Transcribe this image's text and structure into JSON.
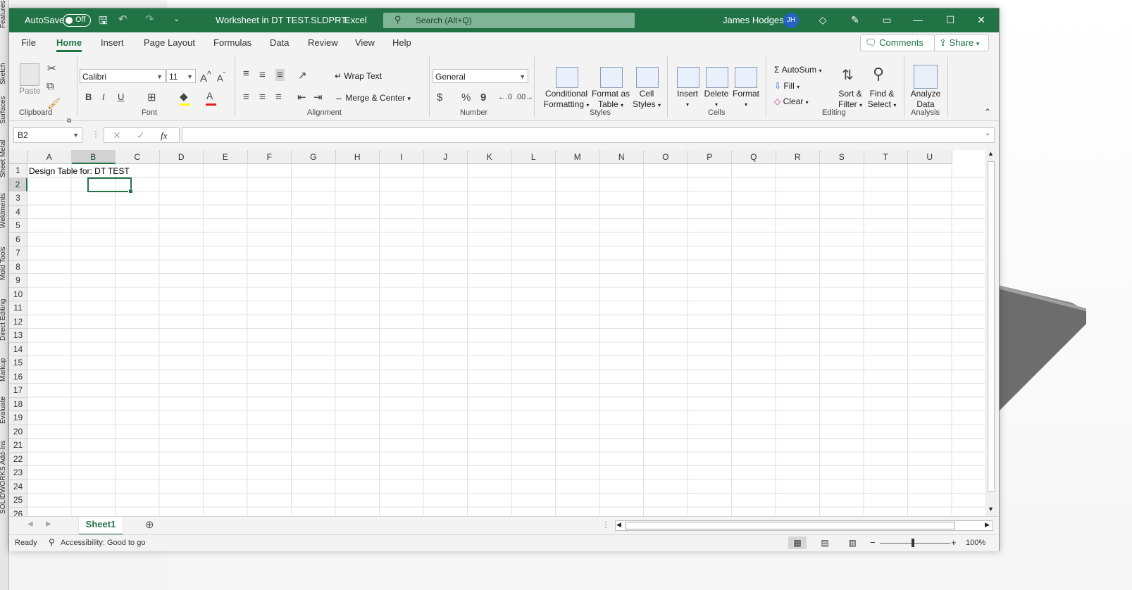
{
  "background_app": {
    "tabs": [
      "Features",
      "Sketch",
      "Surfaces",
      "Sheet Metal",
      "Weldments",
      "Mold Tools",
      "Direct Editing",
      "Markup",
      "Evaluate",
      "SOLIDWORKS Add-Ins"
    ]
  },
  "titlebar": {
    "autosave_label": "AutoSave",
    "autosave_state": "Off",
    "document_title": "Worksheet in DT TEST.SLDPRT",
    "app_name": "Excel",
    "separator": "-",
    "search_placeholder": "Search (Alt+Q)",
    "user_name": "James Hodges",
    "user_initials": "JH",
    "accent_color": "#217346"
  },
  "menu": {
    "tabs": [
      "File",
      "Home",
      "Insert",
      "Page Layout",
      "Formulas",
      "Data",
      "Review",
      "View",
      "Help"
    ],
    "active_tab": "Home",
    "comments_label": "Comments",
    "share_label": "Share"
  },
  "ribbon": {
    "clipboard": {
      "paste_label": "Paste",
      "group_label": "Clipboard"
    },
    "font": {
      "font_name": "Calibri",
      "font_size": "11",
      "bold": "B",
      "italic": "I",
      "underline": "U",
      "group_label": "Font"
    },
    "alignment": {
      "wrap_text": "Wrap Text",
      "merge_center": "Merge & Center",
      "group_label": "Alignment"
    },
    "number": {
      "format": "General",
      "currency": "$",
      "percent": "%",
      "comma": "9",
      "group_label": "Number"
    },
    "styles": {
      "conditional_formatting_1": "Conditional",
      "conditional_formatting_2": "Formatting",
      "format_table_1": "Format as",
      "format_table_2": "Table",
      "cell_styles_1": "Cell",
      "cell_styles_2": "Styles",
      "group_label": "Styles"
    },
    "cells": {
      "insert": "Insert",
      "delete": "Delete",
      "format": "Format",
      "group_label": "Cells"
    },
    "editing": {
      "autosum": "AutoSum",
      "fill": "Fill",
      "clear": "Clear",
      "sort_filter_1": "Sort &",
      "sort_filter_2": "Filter",
      "find_select_1": "Find &",
      "find_select_2": "Select",
      "group_label": "Editing"
    },
    "analysis": {
      "analyze_1": "Analyze",
      "analyze_2": "Data",
      "group_label": "Analysis"
    }
  },
  "formula_bar": {
    "name_box": "B2",
    "fx": "fx",
    "formula": ""
  },
  "sheet": {
    "columns": [
      "A",
      "B",
      "C",
      "D",
      "E",
      "F",
      "G",
      "H",
      "I",
      "J",
      "K",
      "L",
      "M",
      "N",
      "O",
      "P",
      "Q",
      "R",
      "S",
      "T",
      "U"
    ],
    "rows": [
      "1",
      "2",
      "3",
      "4",
      "5",
      "6",
      "7",
      "8",
      "9",
      "10",
      "11",
      "12",
      "13",
      "14",
      "15",
      "16",
      "17",
      "18",
      "19",
      "20",
      "21",
      "22",
      "23",
      "24",
      "25",
      "26"
    ],
    "selected_column": "B",
    "selected_row": "2",
    "cell_A1": "Design Table for: DT TEST",
    "tab_name": "Sheet1"
  },
  "status": {
    "ready": "Ready",
    "accessibility": "Accessibility: Good to go",
    "zoom": "100%",
    "zoom_minus": "−",
    "zoom_plus": "+"
  }
}
